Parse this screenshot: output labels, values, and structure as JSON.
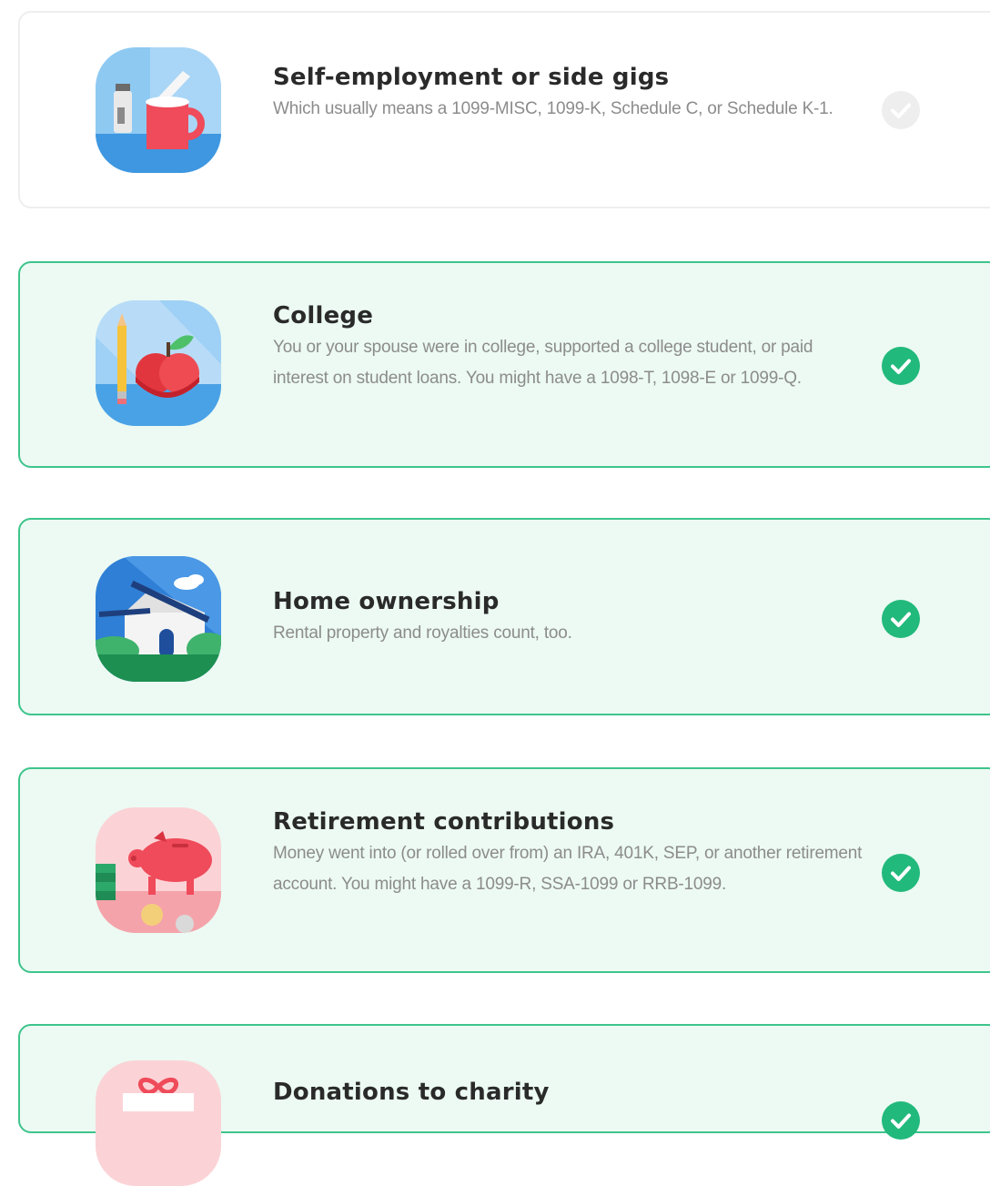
{
  "colors": {
    "selected_border": "#3ec48c",
    "selected_background": "#ecfaf3",
    "check_selected": "#22b97c",
    "check_unselected": "#eeeeee"
  },
  "items": [
    {
      "title": "Self-employment or side gigs",
      "description": "Which usually means a 1099-MISC, 1099-K, Schedule C, or Schedule K-1.",
      "icon": "coffee-mug-salt-shaker-icon",
      "selected": false
    },
    {
      "title": "College",
      "description": "You or your spouse were in college, supported a college student, or paid interest on student loans. You might have a 1098-T, 1098-E or 1099-Q.",
      "icon": "pencil-apple-icon",
      "selected": true
    },
    {
      "title": "Home ownership",
      "description": "Rental property and royalties count, too.",
      "icon": "house-icon",
      "selected": true
    },
    {
      "title": "Retirement contributions",
      "description": "Money went into (or rolled over from) an IRA, 401K, SEP, or another retirement account. You might have a 1099-R, SSA-1099 or RRB-1099.",
      "icon": "piggy-bank-icon",
      "selected": true
    },
    {
      "title": "Donations to charity",
      "description": "",
      "icon": "gift-icon",
      "selected": true
    }
  ]
}
